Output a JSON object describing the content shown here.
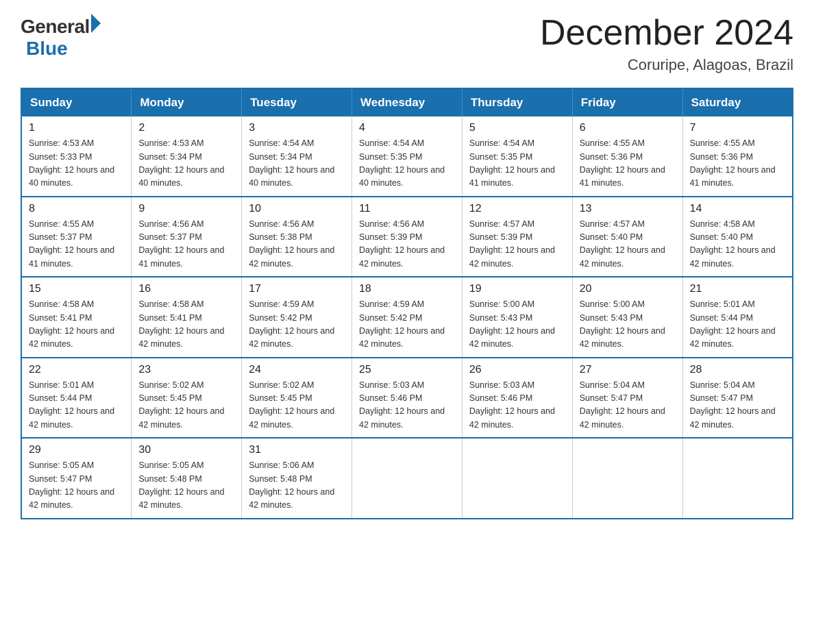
{
  "logo": {
    "general": "General",
    "blue": "Blue"
  },
  "title": "December 2024",
  "subtitle": "Coruripe, Alagoas, Brazil",
  "days_of_week": [
    "Sunday",
    "Monday",
    "Tuesday",
    "Wednesday",
    "Thursday",
    "Friday",
    "Saturday"
  ],
  "weeks": [
    [
      {
        "day": "1",
        "sunrise": "Sunrise: 4:53 AM",
        "sunset": "Sunset: 5:33 PM",
        "daylight": "Daylight: 12 hours and 40 minutes."
      },
      {
        "day": "2",
        "sunrise": "Sunrise: 4:53 AM",
        "sunset": "Sunset: 5:34 PM",
        "daylight": "Daylight: 12 hours and 40 minutes."
      },
      {
        "day": "3",
        "sunrise": "Sunrise: 4:54 AM",
        "sunset": "Sunset: 5:34 PM",
        "daylight": "Daylight: 12 hours and 40 minutes."
      },
      {
        "day": "4",
        "sunrise": "Sunrise: 4:54 AM",
        "sunset": "Sunset: 5:35 PM",
        "daylight": "Daylight: 12 hours and 40 minutes."
      },
      {
        "day": "5",
        "sunrise": "Sunrise: 4:54 AM",
        "sunset": "Sunset: 5:35 PM",
        "daylight": "Daylight: 12 hours and 41 minutes."
      },
      {
        "day": "6",
        "sunrise": "Sunrise: 4:55 AM",
        "sunset": "Sunset: 5:36 PM",
        "daylight": "Daylight: 12 hours and 41 minutes."
      },
      {
        "day": "7",
        "sunrise": "Sunrise: 4:55 AM",
        "sunset": "Sunset: 5:36 PM",
        "daylight": "Daylight: 12 hours and 41 minutes."
      }
    ],
    [
      {
        "day": "8",
        "sunrise": "Sunrise: 4:55 AM",
        "sunset": "Sunset: 5:37 PM",
        "daylight": "Daylight: 12 hours and 41 minutes."
      },
      {
        "day": "9",
        "sunrise": "Sunrise: 4:56 AM",
        "sunset": "Sunset: 5:37 PM",
        "daylight": "Daylight: 12 hours and 41 minutes."
      },
      {
        "day": "10",
        "sunrise": "Sunrise: 4:56 AM",
        "sunset": "Sunset: 5:38 PM",
        "daylight": "Daylight: 12 hours and 42 minutes."
      },
      {
        "day": "11",
        "sunrise": "Sunrise: 4:56 AM",
        "sunset": "Sunset: 5:39 PM",
        "daylight": "Daylight: 12 hours and 42 minutes."
      },
      {
        "day": "12",
        "sunrise": "Sunrise: 4:57 AM",
        "sunset": "Sunset: 5:39 PM",
        "daylight": "Daylight: 12 hours and 42 minutes."
      },
      {
        "day": "13",
        "sunrise": "Sunrise: 4:57 AM",
        "sunset": "Sunset: 5:40 PM",
        "daylight": "Daylight: 12 hours and 42 minutes."
      },
      {
        "day": "14",
        "sunrise": "Sunrise: 4:58 AM",
        "sunset": "Sunset: 5:40 PM",
        "daylight": "Daylight: 12 hours and 42 minutes."
      }
    ],
    [
      {
        "day": "15",
        "sunrise": "Sunrise: 4:58 AM",
        "sunset": "Sunset: 5:41 PM",
        "daylight": "Daylight: 12 hours and 42 minutes."
      },
      {
        "day": "16",
        "sunrise": "Sunrise: 4:58 AM",
        "sunset": "Sunset: 5:41 PM",
        "daylight": "Daylight: 12 hours and 42 minutes."
      },
      {
        "day": "17",
        "sunrise": "Sunrise: 4:59 AM",
        "sunset": "Sunset: 5:42 PM",
        "daylight": "Daylight: 12 hours and 42 minutes."
      },
      {
        "day": "18",
        "sunrise": "Sunrise: 4:59 AM",
        "sunset": "Sunset: 5:42 PM",
        "daylight": "Daylight: 12 hours and 42 minutes."
      },
      {
        "day": "19",
        "sunrise": "Sunrise: 5:00 AM",
        "sunset": "Sunset: 5:43 PM",
        "daylight": "Daylight: 12 hours and 42 minutes."
      },
      {
        "day": "20",
        "sunrise": "Sunrise: 5:00 AM",
        "sunset": "Sunset: 5:43 PM",
        "daylight": "Daylight: 12 hours and 42 minutes."
      },
      {
        "day": "21",
        "sunrise": "Sunrise: 5:01 AM",
        "sunset": "Sunset: 5:44 PM",
        "daylight": "Daylight: 12 hours and 42 minutes."
      }
    ],
    [
      {
        "day": "22",
        "sunrise": "Sunrise: 5:01 AM",
        "sunset": "Sunset: 5:44 PM",
        "daylight": "Daylight: 12 hours and 42 minutes."
      },
      {
        "day": "23",
        "sunrise": "Sunrise: 5:02 AM",
        "sunset": "Sunset: 5:45 PM",
        "daylight": "Daylight: 12 hours and 42 minutes."
      },
      {
        "day": "24",
        "sunrise": "Sunrise: 5:02 AM",
        "sunset": "Sunset: 5:45 PM",
        "daylight": "Daylight: 12 hours and 42 minutes."
      },
      {
        "day": "25",
        "sunrise": "Sunrise: 5:03 AM",
        "sunset": "Sunset: 5:46 PM",
        "daylight": "Daylight: 12 hours and 42 minutes."
      },
      {
        "day": "26",
        "sunrise": "Sunrise: 5:03 AM",
        "sunset": "Sunset: 5:46 PM",
        "daylight": "Daylight: 12 hours and 42 minutes."
      },
      {
        "day": "27",
        "sunrise": "Sunrise: 5:04 AM",
        "sunset": "Sunset: 5:47 PM",
        "daylight": "Daylight: 12 hours and 42 minutes."
      },
      {
        "day": "28",
        "sunrise": "Sunrise: 5:04 AM",
        "sunset": "Sunset: 5:47 PM",
        "daylight": "Daylight: 12 hours and 42 minutes."
      }
    ],
    [
      {
        "day": "29",
        "sunrise": "Sunrise: 5:05 AM",
        "sunset": "Sunset: 5:47 PM",
        "daylight": "Daylight: 12 hours and 42 minutes."
      },
      {
        "day": "30",
        "sunrise": "Sunrise: 5:05 AM",
        "sunset": "Sunset: 5:48 PM",
        "daylight": "Daylight: 12 hours and 42 minutes."
      },
      {
        "day": "31",
        "sunrise": "Sunrise: 5:06 AM",
        "sunset": "Sunset: 5:48 PM",
        "daylight": "Daylight: 12 hours and 42 minutes."
      },
      null,
      null,
      null,
      null
    ]
  ]
}
